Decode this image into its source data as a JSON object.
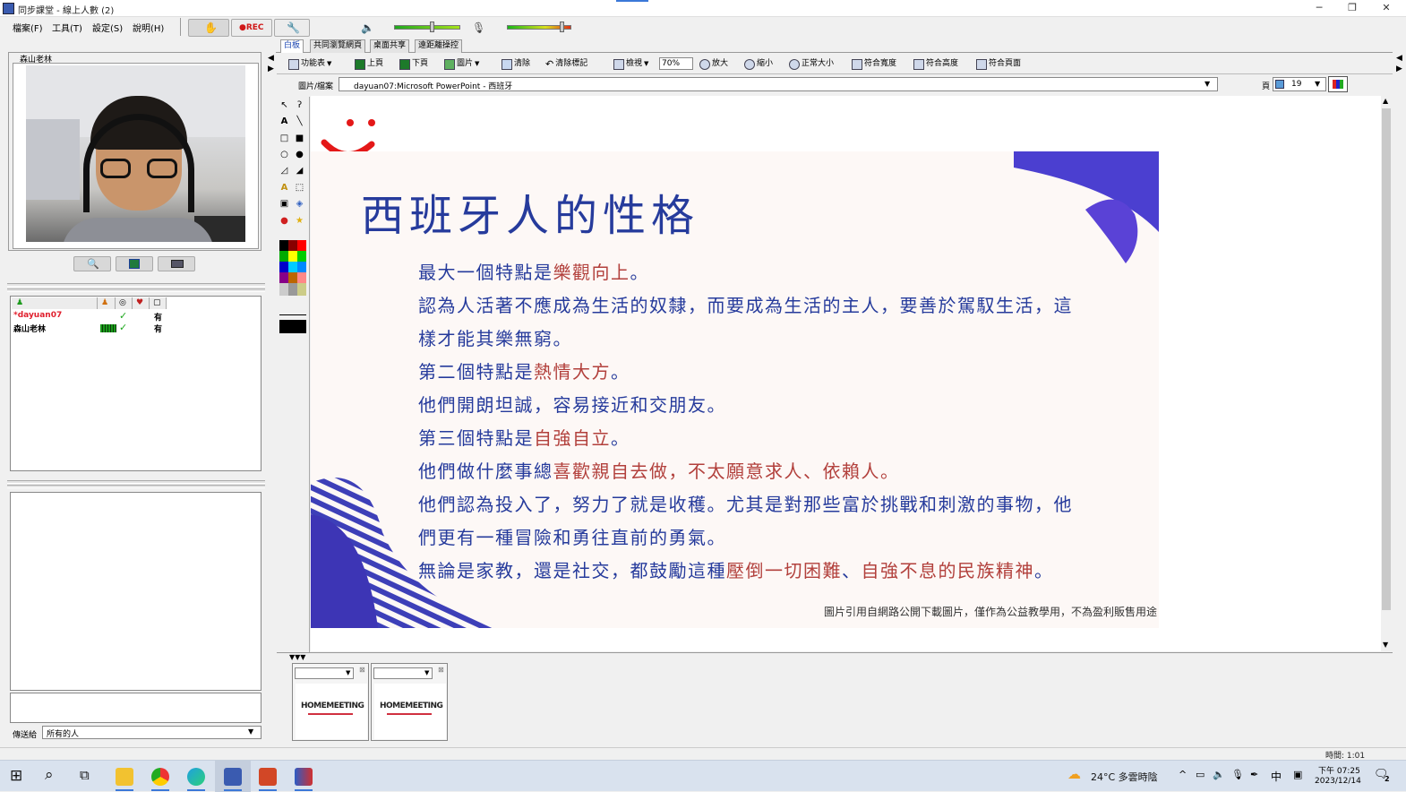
{
  "window": {
    "title": "同步課堂 - 線上人數 (2)",
    "minimize": "─",
    "restore": "❐",
    "close": "✕"
  },
  "menu": [
    "檔案(F)",
    "工具(T)",
    "設定(S)",
    "說明(H)"
  ],
  "toolbar": {
    "rec_label": "●REC"
  },
  "video": {
    "caption": "森山老林"
  },
  "video_buttons": [
    "search-icon",
    "network-icon",
    "camera-icon"
  ],
  "userlist": {
    "rows": [
      {
        "name": "*dayuan07",
        "status": "✓",
        "value": "有",
        "color": "#e0202e"
      },
      {
        "name": "森山老林",
        "status": "✓",
        "value": "有",
        "color": "#000000"
      }
    ]
  },
  "sendto": {
    "label": "傳送給",
    "value": "所有的人"
  },
  "tabs": [
    "白板",
    "共同瀏覽網頁",
    "桌面共享",
    "遠距離操控"
  ],
  "tools": {
    "function_menu": "功能表",
    "prev_page": "上頁",
    "next_page": "下頁",
    "picture": "圖片",
    "clear": "清除",
    "clear_marks": "清除標記",
    "view": "檢視",
    "zoom_value": "70%",
    "zoom_in": "放大",
    "zoom_out": "縮小",
    "normal_size": "正常大小",
    "fit_width": "符合寬度",
    "fit_height": "符合高度",
    "fit_page": "符合頁面"
  },
  "filebar": {
    "label": "圖片/檔案",
    "file": "dayuan07:Microsoft PowerPoint - 西班牙",
    "page_label": "頁",
    "page_value": "19"
  },
  "slide": {
    "title": "西班牙人的性格",
    "l1a": "最大一個特點是",
    "l1b": "樂觀向上",
    "l1c": "。",
    "l2": "認為人活著不應成為生活的奴隸，而要成為生活的主人，要善於駕馭生活，這",
    "l3": "樣才能其樂無窮。",
    "l4a": "第二個特點是",
    "l4b": "熱情大方",
    "l4c": "。",
    "l5": "他們開朗坦誠，容易接近和交朋友。",
    "l6a": "第三個特點是",
    "l6b": "自強自立",
    "l6c": "。",
    "l7a": "他們做什麼事總",
    "l7b": "喜歡親自去做",
    "l7c": "，不太願意求人、依賴人。",
    "l8": "他們認為投入了，努力了就是收穫。尤其是對那些富於挑戰和刺激的事物，他",
    "l9": "們更有一種冒險和勇往直前的勇氣。",
    "l10a": "無論是家教，還是社交，都鼓勵這種",
    "l10b": "壓倒一切困難",
    "l10c": "、",
    "l10d": "自強不息的民族精神",
    "l10e": "。",
    "footer": "圖片引用自網路公開下載圖片，僅作為公益教學用，不為盈利販售用途"
  },
  "thumbnails": [
    "HOMEMEETING",
    "HOMEMEETING"
  ],
  "status": {
    "time": "時間: 1:01"
  },
  "taskbar": {
    "weather": "24°C 多雲時陰",
    "ime": "中",
    "clock_time": "下午 07:25",
    "clock_date": "2023/12/14",
    "notif_count": "2"
  },
  "colors": {
    "slide_blue": "#263b9c",
    "slide_red": "#b2403c",
    "accent_purple": "#4b3fd0"
  }
}
